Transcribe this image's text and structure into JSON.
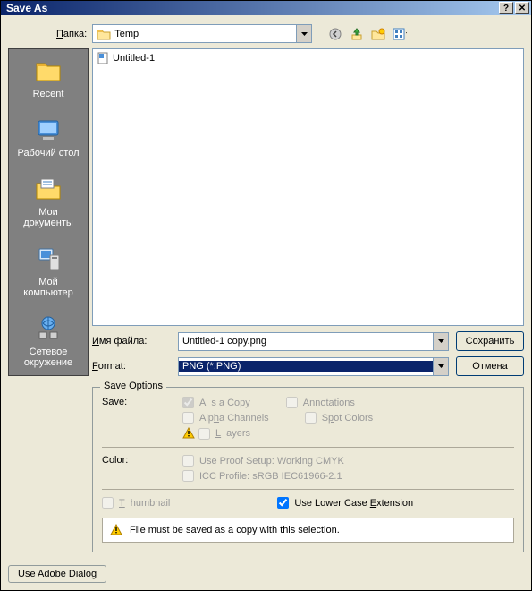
{
  "title": "Save As",
  "folder_label": "Папка:",
  "folder_value": "Temp",
  "sidebar": [
    {
      "label": "Recent"
    },
    {
      "label": "Рабочий стол"
    },
    {
      "label": "Мои документы"
    },
    {
      "label": "Мой компьютер"
    },
    {
      "label": "Сетевое окружение"
    }
  ],
  "file_list": [
    {
      "name": "Untitled-1"
    }
  ],
  "filename_label": "Имя файла:",
  "filename_value": "Untitled-1 copy.png",
  "format_label": "Format:",
  "format_value": "PNG (*.PNG)",
  "save_btn": "Сохранить",
  "cancel_btn": "Отмена",
  "save_options": {
    "legend": "Save Options",
    "save_label": "Save:",
    "as_copy": "As a Copy",
    "annotations": "Annotations",
    "alpha": "Alpha Channels",
    "spot": "Spot Colors",
    "layers": "Layers",
    "color_label": "Color:",
    "proof": "Use Proof Setup:   Working CMYK",
    "icc": "ICC Profile:  sRGB IEC61966-2.1",
    "thumbnail": "Thumbnail",
    "lowercase": "Use Lower Case Extension",
    "warning": "File must be saved as a copy with this selection."
  },
  "adobe_btn": "Use Adobe Dialog"
}
